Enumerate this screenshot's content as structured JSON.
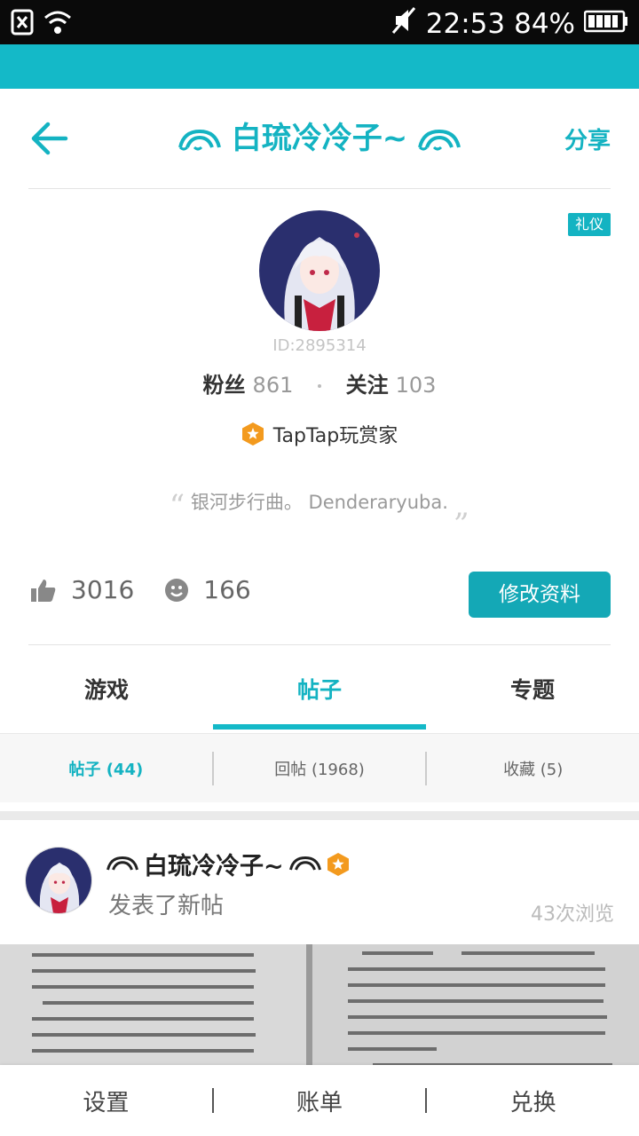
{
  "status_bar": {
    "time": "22:53",
    "battery": "84%"
  },
  "header": {
    "title": "白琉冷冷子~",
    "share_label": "分享"
  },
  "profile": {
    "badge": "礼仪",
    "id_text": "ID:2895314",
    "fans_label": "粉丝",
    "fans_count": "861",
    "following_label": "关注",
    "following_count": "103",
    "rank_title": "TapTap玩赏家",
    "quote": "银河步行曲。 Denderaryuba.",
    "likes": "3016",
    "smiles": "166",
    "edit_label": "修改资料"
  },
  "tabs": [
    "游戏",
    "帖子",
    "专题"
  ],
  "subtabs": [
    "帖子 (44)",
    "回帖 (1968)",
    "收藏 (5)"
  ],
  "post": {
    "author": "白琉冷冷子~",
    "action": "发表了新帖",
    "views": "43次浏览"
  },
  "bottom_bar": [
    "设置",
    "账单",
    "兑换"
  ],
  "colors": {
    "accent": "#14b9c8",
    "button": "#14a8b6",
    "rank_badge": "#f39a1e"
  }
}
